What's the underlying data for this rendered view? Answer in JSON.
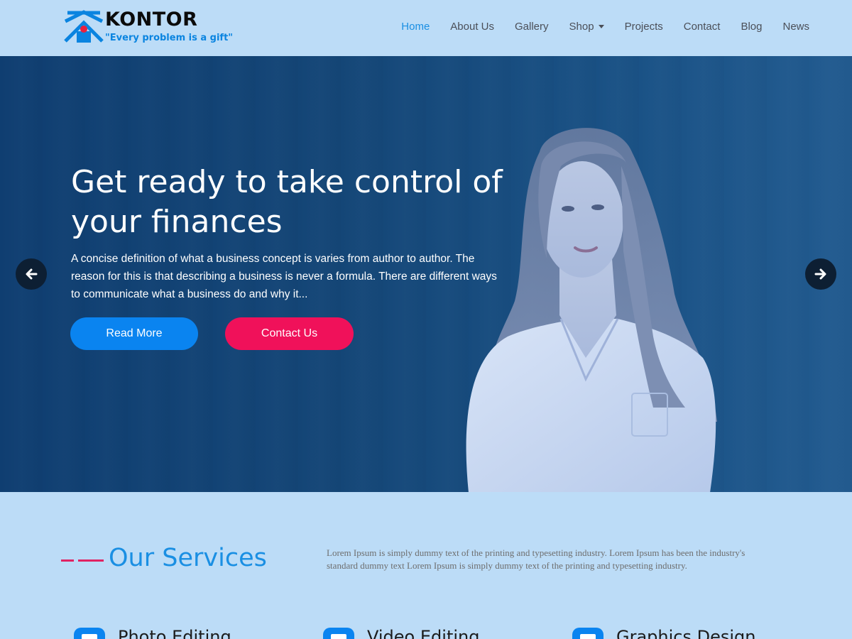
{
  "brand": {
    "name": "KONTOR",
    "tagline": "\"Every problem is a gift\""
  },
  "nav": {
    "items": [
      {
        "label": "Home",
        "active": true
      },
      {
        "label": "About Us"
      },
      {
        "label": "Gallery"
      },
      {
        "label": "Shop",
        "has_dropdown": true
      },
      {
        "label": "Projects"
      },
      {
        "label": "Contact"
      },
      {
        "label": "Blog"
      },
      {
        "label": "News"
      }
    ]
  },
  "hero": {
    "title": "Get ready to take control of your finances",
    "description": "A concise definition of what a business concept is varies from author to author. The reason for this is that describing a business is never a formula. There are different ways to communicate what a business do and why it...",
    "read_more_label": "Read More",
    "contact_label": "Contact Us",
    "prev_icon": "arrow-left-icon",
    "next_icon": "arrow-right-icon"
  },
  "services": {
    "title": "Our Services",
    "description": "Lorem Ipsum is simply dummy text of the printing and typesetting industry. Lorem Ipsum has been the industry's standard dummy text Lorem Ipsum is simply dummy text of the printing and typesetting industry.",
    "items": [
      {
        "label": "Photo Editing",
        "icon": "photo-icon"
      },
      {
        "label": "Video Editing",
        "icon": "video-icon"
      },
      {
        "label": "Graphics Design",
        "icon": "design-icon"
      }
    ]
  },
  "colors": {
    "page_bg": "#bcdcf7",
    "hero_bg": "#144677",
    "accent_blue": "#0a84f0",
    "accent_pink": "#f0115a",
    "nav_active": "#1a8fe3"
  }
}
